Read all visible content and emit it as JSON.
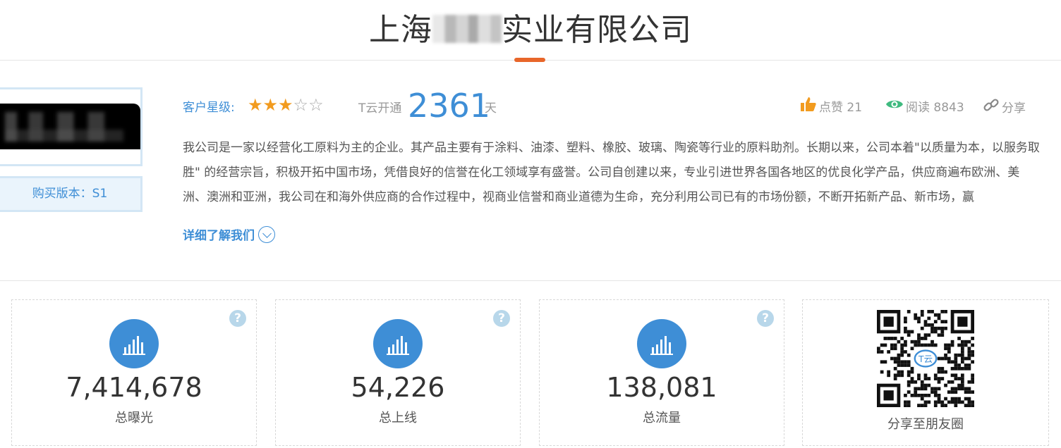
{
  "company": {
    "name_prefix": "上海",
    "name_suffix": "实业有限公司"
  },
  "sidebar": {
    "version_label": "购买版本：S1"
  },
  "info": {
    "rating_label": "客户星级:",
    "rating_value": 3,
    "rating_max": 5,
    "tyun_label": "T云开通",
    "days": "2361",
    "days_unit": "天"
  },
  "actions": {
    "like_label": "点赞 21",
    "read_label": "阅读 8843",
    "share_label": "分享"
  },
  "description": "我公司是一家以经营化工原料为主的企业。其产品主要有于涂料、油漆、塑料、橡胶、玻璃、陶瓷等行业的原料助剂。长期以来，公司本着\"以质量为本，以服务取胜\" 的经营宗旨，积极开拓中国市场，凭借良好的信誉在化工领域享有盛誉。公司自创建以来，专业引进世界各国各地区的优良化学产品，供应商遍布欧洲、美洲、澳洲和亚洲，我公司在和海外供应商的合作过程中，视商业信誉和商业道德为生命，充分利用公司已有的市场份额，不断开拓新产品、新市场，赢",
  "more_label": "详细了解我们",
  "stats": [
    {
      "value": "7,414,678",
      "label": "总曝光"
    },
    {
      "value": "54,226",
      "label": "总上线"
    },
    {
      "value": "138,081",
      "label": "总流量"
    }
  ],
  "help_glyph": "?",
  "qr": {
    "label": "分享至朋友圈",
    "center_text": "T云"
  },
  "colors": {
    "accent_orange": "#e8662a",
    "brand_blue": "#3e8ed6",
    "star_on": "#f29b1f",
    "eye_green": "#3fba7f"
  }
}
